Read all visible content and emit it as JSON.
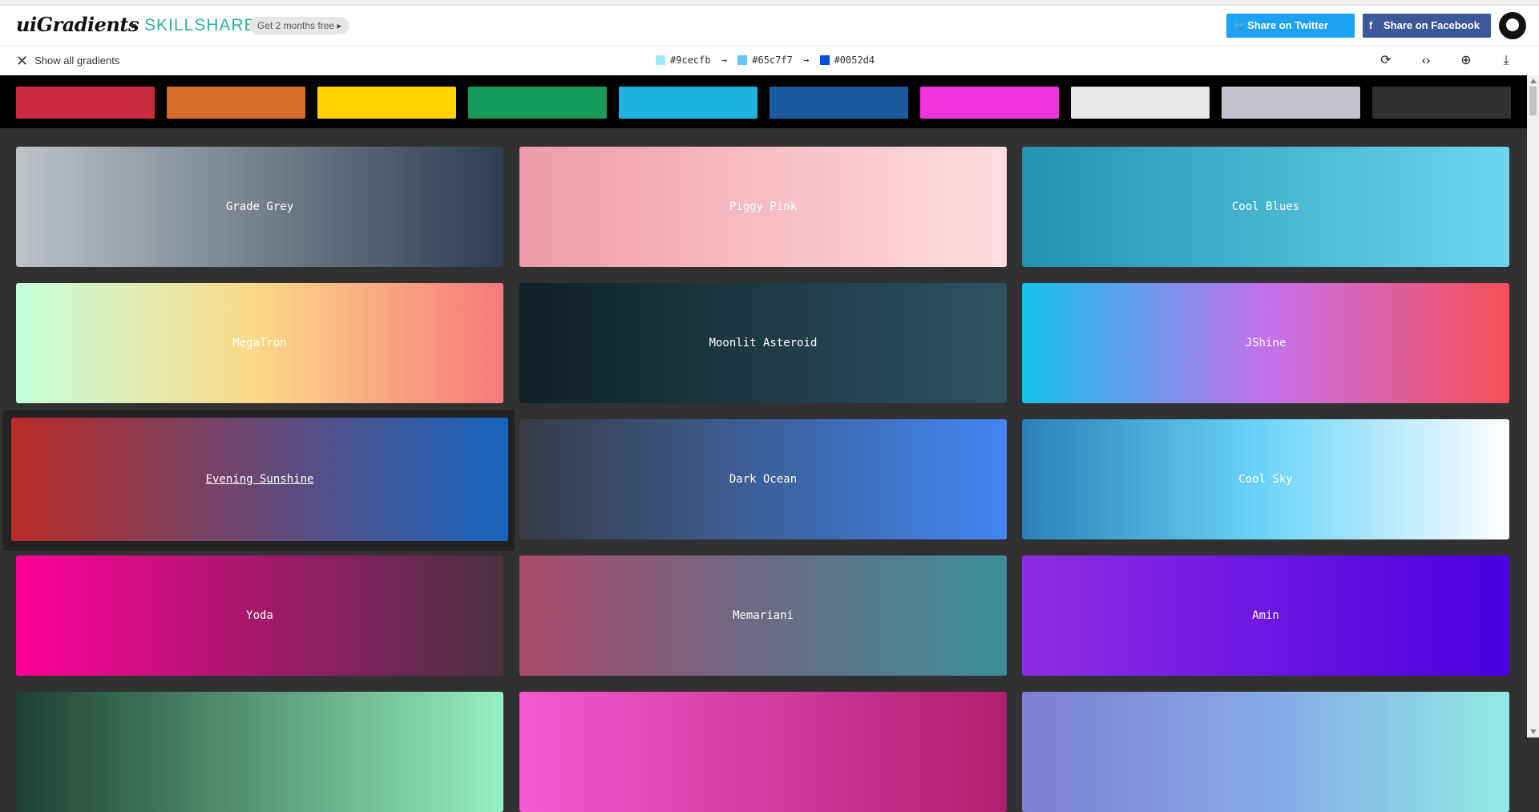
{
  "header": {
    "logo": "uiGradients",
    "plus": "+",
    "partner": "SKILLSHARE",
    "promo": "Get 2 months free ▸",
    "twitter_label": "Share on Twitter",
    "facebook_label": "Share on Facebook"
  },
  "toolbar": {
    "show_all": "Show all gradients",
    "colors": [
      {
        "hex": "#9cecfb",
        "color": "#9cecfb"
      },
      {
        "hex": "#65c7f7",
        "color": "#65c7f7"
      },
      {
        "hex": "#0052d4",
        "color": "#0052d4"
      }
    ],
    "arrow": "→"
  },
  "palette": [
    "#cc2a41",
    "#d96b29",
    "#ffd200",
    "#169a59",
    "#1db4e0",
    "#1b5aa0",
    "#f033dc",
    "#e8e8e8",
    "#c2c2cc",
    "#313131"
  ],
  "gradients": [
    {
      "name": "Grade Grey",
      "from": "#bdc3c7",
      "to": "#2c3e50"
    },
    {
      "name": "Piggy Pink",
      "from": "#ee9ca7",
      "to": "#ffdde1"
    },
    {
      "name": "Cool Blues",
      "from": "#2193b0",
      "to": "#6dd5ed"
    },
    {
      "name": "MegaTron",
      "from": "#c6ffdd",
      "via": "#fbd786",
      "to": "#f7797d"
    },
    {
      "name": "Moonlit Asteroid",
      "from": "#0f2027",
      "via": "#203a43",
      "to": "#2c5364"
    },
    {
      "name": "JShine",
      "from": "#12c2e9",
      "via": "#c471ed",
      "to": "#f64f59"
    },
    {
      "name": "Evening Sunshine",
      "from": "#b92b27",
      "to": "#1565c0"
    },
    {
      "name": "Dark Ocean",
      "from": "#373b44",
      "to": "#4286f4"
    },
    {
      "name": "Cool Sky",
      "from": "#2980b9",
      "via": "#6dd5fa",
      "to": "#ffffff"
    },
    {
      "name": "Yoda",
      "from": "#ff0099",
      "to": "#493240"
    },
    {
      "name": "Memariani",
      "from": "#aa4b6b",
      "via": "#6b6b83",
      "to": "#3b8d99"
    },
    {
      "name": "Amin",
      "from": "#8e2de2",
      "to": "#4a00e0"
    },
    {
      "name": "",
      "from": "#1d4033",
      "to": "#96f0c0"
    },
    {
      "name": "",
      "from": "#f35bd1",
      "to": "#b01e6f"
    },
    {
      "name": "",
      "from": "#7f7fd5",
      "via": "#86a8e7",
      "to": "#91eae4"
    }
  ]
}
